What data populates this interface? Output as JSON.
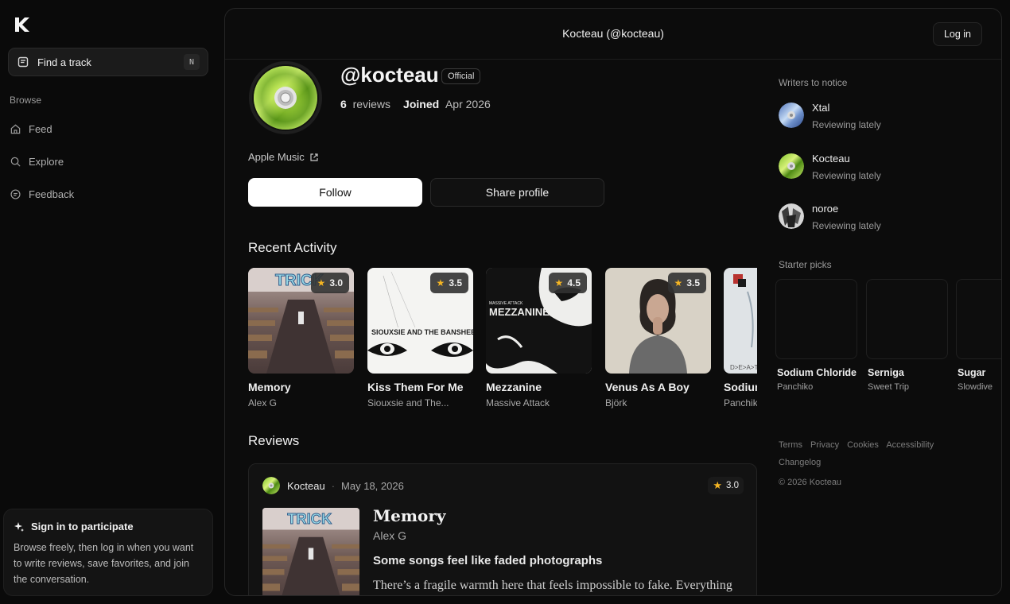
{
  "sidebar": {
    "search_label": "Find a track",
    "search_shortcut": "N",
    "browse_heading": "Browse",
    "nav": [
      {
        "label": "Feed",
        "icon": "home-icon"
      },
      {
        "label": "Explore",
        "icon": "search-icon"
      },
      {
        "label": "Feedback",
        "icon": "chat-icon"
      }
    ],
    "signin": {
      "title": "Sign in to participate",
      "body": "Browse freely, then log in when you want to write reviews, save favorites, and join the conversation."
    }
  },
  "header": {
    "title": "Kocteau (@kocteau)",
    "login_label": "Log in"
  },
  "profile": {
    "handle": "@kocteau",
    "badge": "Official",
    "review_count": "6",
    "reviews_label": "reviews",
    "joined_label": "Joined",
    "joined_date": "Apr 2026",
    "link_label": "Apple Music",
    "follow_label": "Follow",
    "share_label": "Share profile"
  },
  "recent": {
    "heading": "Recent Activity",
    "items": [
      {
        "title": "Memory",
        "artist": "Alex G",
        "rating": "3.0",
        "art": "trick"
      },
      {
        "title": "Kiss Them For Me",
        "artist": "Siouxsie and The...",
        "rating": "3.5",
        "art": "siouxsie"
      },
      {
        "title": "Mezzanine",
        "artist": "Massive Attack",
        "rating": "4.5",
        "art": "mezzanine"
      },
      {
        "title": "Venus As A Boy",
        "artist": "Björk",
        "rating": "3.5",
        "art": "bjork"
      },
      {
        "title": "Sodium Chloride",
        "artist": "Panchiko",
        "rating": "",
        "art": "panchiko"
      }
    ]
  },
  "reviews": {
    "heading": "Reviews",
    "items": [
      {
        "author": "Kocteau",
        "date": "May 18, 2026",
        "rating": "3.0",
        "title": "Memory",
        "artist": "Alex G",
        "headline": "Some songs feel like faded photographs",
        "body": "There’s a fragile warmth here that feels impossible to fake. Everything"
      }
    ]
  },
  "right": {
    "writers_heading": "Writers to notice",
    "writers": [
      {
        "name": "Xtal",
        "sub": "Reviewing lately"
      },
      {
        "name": "Kocteau",
        "sub": "Reviewing lately"
      },
      {
        "name": "noroe",
        "sub": "Reviewing lately"
      }
    ],
    "picks_heading": "Starter picks",
    "picks": [
      {
        "title": "Sodium Chloride",
        "artist": "Panchiko"
      },
      {
        "title": "Serniga",
        "artist": "Sweet Trip"
      },
      {
        "title": "Sugar",
        "artist": "Slowdive"
      }
    ],
    "footer_links": [
      "Terms",
      "Privacy",
      "Cookies",
      "Accessibility",
      "Changelog"
    ],
    "copyright": "© 2026 Kocteau"
  },
  "colors": {
    "accent_star": "#f5b523",
    "background": "#0a0a0a",
    "panel": "#0c0c0c"
  }
}
